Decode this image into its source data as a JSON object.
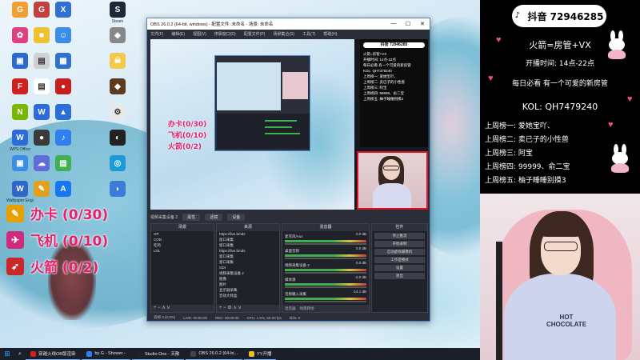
{
  "desktop": {
    "icons": [
      {
        "label": "",
        "color": "#f0a030",
        "glyph": "G"
      },
      {
        "label": "",
        "color": "#c04040",
        "glyph": "G"
      },
      {
        "label": "",
        "color": "#3070d0",
        "glyph": "X"
      },
      {
        "label": "Steam",
        "color": "#1b2838",
        "glyph": "S"
      },
      {
        "label": "",
        "color": "#e04080",
        "glyph": "✿"
      },
      {
        "label": "",
        "color": "#f0c030",
        "glyph": "■"
      },
      {
        "label": "",
        "color": "#3a8ee8",
        "glyph": "☺"
      },
      {
        "label": "",
        "color": "#888",
        "glyph": "◆"
      },
      {
        "label": "",
        "color": "#2a6ad0",
        "glyph": "▣"
      },
      {
        "label": "",
        "color": "#d0d0d0",
        "glyph": "▤"
      },
      {
        "label": "",
        "color": "#3070d0",
        "glyph": "▦"
      },
      {
        "label": "",
        "color": "#f2c94c",
        "glyph": "☠"
      },
      {
        "label": "",
        "color": "#d02020",
        "glyph": "F"
      },
      {
        "label": "",
        "color": "#ffffff",
        "glyph": "▤"
      },
      {
        "label": "",
        "color": "#c81e1e",
        "glyph": "●"
      },
      {
        "label": "",
        "color": "#5c3a1e",
        "glyph": "◆"
      },
      {
        "label": "",
        "color": "#76b900",
        "glyph": "N"
      },
      {
        "label": "",
        "color": "#2d6cd8",
        "glyph": "W"
      },
      {
        "label": "",
        "color": "#e8e8e8",
        "glyph": "⚙"
      },
      {
        "label": "",
        "color": "#222",
        "glyph": "◐"
      },
      {
        "label": "WPS Office",
        "color": "#2d6cd8",
        "glyph": "W"
      },
      {
        "label": "",
        "color": "#3a3a3a",
        "glyph": "●"
      },
      {
        "label": "",
        "color": "#2e7ff0",
        "glyph": "♪"
      },
      {
        "label": "",
        "color": "#1a9bd8",
        "glyph": "◎"
      },
      {
        "label": "",
        "color": "#3a8ee8",
        "glyph": "▣"
      },
      {
        "label": "",
        "color": "#5f6dd8",
        "glyph": "☁"
      },
      {
        "label": "",
        "color": "#40b050",
        "glyph": "▤"
      },
      {
        "label": "Wallpaper Engine",
        "color": "#2f66c7",
        "glyph": "W"
      },
      {
        "label": "",
        "color": "#e0a020",
        "glyph": "✎"
      },
      {
        "label": "",
        "color": "#1876f2",
        "glyph": "A"
      },
      {
        "label": "",
        "color": "#3a7cd8",
        "glyph": "◗"
      },
      {
        "label": "",
        "color": "#2b6ed8",
        "glyph": "▲"
      }
    ]
  },
  "tasks": [
    {
      "text": "办卡 (0/30)",
      "color": "#e6a100",
      "glyph": "✎"
    },
    {
      "text": "飞机 (0/10)",
      "color": "#d02a7a",
      "glyph": "✈"
    },
    {
      "text": "火箭 (0/2)",
      "color": "#c82828",
      "glyph": "➶"
    }
  ],
  "obs": {
    "title": "OBS 26.0.2 (64-bit, windows) - 配置文件: 未命名 - 场景: 未命名",
    "menu": [
      "文件(F)",
      "编辑(E)",
      "视图(V)",
      "停靠窗口(D)",
      "配置文件(P)",
      "场景集合(S)",
      "工具(T)",
      "帮助(H)"
    ],
    "preview_red": [
      "办卡(0/30)",
      "飞机(0/10)",
      "火箭(0/2)"
    ],
    "preview_panel": {
      "title": "抖音 72946285",
      "lines": [
        "火箭=房管+VX",
        "开播时间: 14点-22点",
        "每日必看 有一个可爱的新房管",
        "KOL: QH7479240",
        "上周榜一: 爱她宝吖、",
        "上周榜二: 卖已子的小性兽",
        "上周榜三: 阿宝",
        "上周榜四: 99999、俞二宝",
        "上周榜五: 柚子睡睡别摸3"
      ]
    },
    "toolbar": {
      "source_label": "视频采集设备 2",
      "props": "属性",
      "filters": "滤镜",
      "device": "设备"
    },
    "docks": {
      "scenes": {
        "title": "场景",
        "items": [
          "GP",
          "COD",
          "吃鸡",
          "LOL"
        ]
      },
      "sources": {
        "title": "来源",
        "items": [
          "https://live.bmds",
          "窗口采集",
          "窗口采集",
          "https://live.bmds",
          "窗口采集",
          "窗口采集",
          "GDI",
          "视频采集设备 2",
          "图像",
          "图片",
          "显示器采集",
          "音效大师盒"
        ]
      },
      "mixer": {
        "title": "混音器",
        "rows": [
          {
            "name": "麦克风/Aux",
            "db": "0.0 dB"
          },
          {
            "name": "桌面音频",
            "db": "0.0 dB"
          },
          {
            "name": "视频采集设备 2",
            "db": "0.0 dB"
          },
          {
            "name": "媒体源",
            "db": "-2.0 dB"
          },
          {
            "name": "音频输入采集",
            "db": "-14.1 dB"
          }
        ],
        "tabs": [
          "混音器",
          "场景转场"
        ]
      },
      "controls": {
        "title": "控件",
        "buttons": [
          "停止推流",
          "开始录制",
          "启动虚拟摄像机",
          "工作室模式",
          "设置",
          "退出"
        ]
      }
    },
    "status": [
      "丢帧 0 (0.0%)",
      "LIVE: 00:00:00",
      "REC: 00:00:00",
      "CPU: 1.6%, 60.00 fps",
      "kb/s: 0"
    ]
  },
  "side": {
    "douyin": "抖音 72946285",
    "manager": "火箭=房管+VX",
    "time": "开播时间: 14点-22点",
    "slogan": "每日必看 有一个可爱的新房管",
    "kol": "KOL: QH7479240",
    "ranks": [
      "上周榜一: 爱她宝吖、",
      "上周榜二: 卖已子的小性兽",
      "上周榜三: 阿宝",
      "上周榜四: 99999、俞二宝",
      "上周榜五: 柚子睡睡别摸3"
    ],
    "hoodie_text": "HOT CHOCOLATE"
  },
  "taskbar": {
    "start_icon": "windows-icon",
    "apps": [
      {
        "label": "穿越火线OB版渲染",
        "color": "#d02020"
      },
      {
        "label": "by G - Shower -",
        "color": "#2e7ff0"
      },
      {
        "label": "Studio One - 天散",
        "color": "#222"
      },
      {
        "label": "OBS 26.0.2 (64-bi...",
        "color": "#444"
      },
      {
        "label": "YY开播",
        "color": "#f0c020"
      }
    ]
  }
}
